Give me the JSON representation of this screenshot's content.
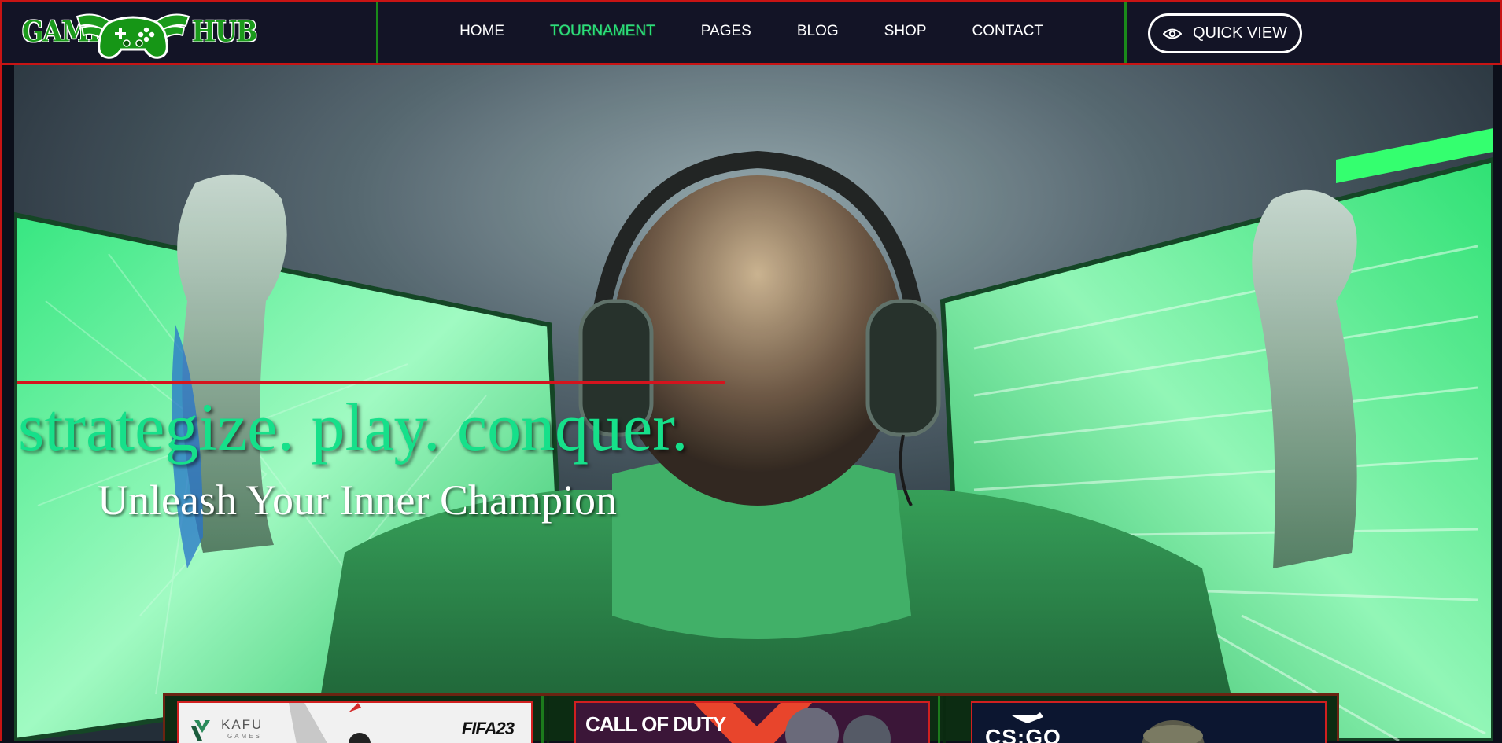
{
  "header": {
    "logo": {
      "left_word": "GAME",
      "right_word": "HUB"
    },
    "nav": [
      {
        "label": "HOME",
        "active": false
      },
      {
        "label": "TOURNAMENT",
        "active": true
      },
      {
        "label": "PAGES",
        "active": false
      },
      {
        "label": "BLOG",
        "active": false
      },
      {
        "label": "SHOP",
        "active": false
      },
      {
        "label": "CONTACT",
        "active": false
      }
    ],
    "quick_view": {
      "label": "QUICK VIEW",
      "icon": "eye-icon"
    }
  },
  "hero": {
    "title": "strategize. play. conquer.",
    "subtitle": "Unleash Your Inner Champion"
  },
  "cards": [
    {
      "brand": "KAFU",
      "brand_sub": "GAMES",
      "game": "FIFA23"
    },
    {
      "game": "CALL OF DUTY"
    },
    {
      "game": "CS:GO"
    }
  ],
  "colors": {
    "accent_green": "#16e08a",
    "nav_active": "#27e07a",
    "border_red": "#c81414",
    "divider_green": "#1a8a1a",
    "header_bg": "#131426"
  }
}
